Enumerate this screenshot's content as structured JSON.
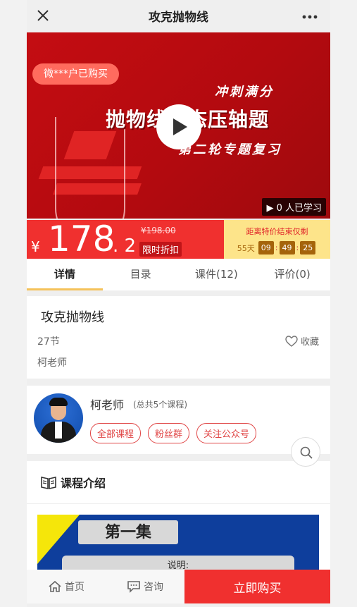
{
  "header": {
    "title": "攻克抛物线"
  },
  "banner": {
    "buyer_badge": "微***户已购买",
    "line1": "冲刺满分",
    "line2": "抛物线动态压轴题",
    "line3": "第二轮专题复习",
    "learners": "0 人已学习"
  },
  "price": {
    "currency": "¥",
    "integer": "178",
    "decimal": ". 2",
    "original": "¥198.00",
    "tag": "限时折扣",
    "countdown_label": "距离特价结束仅剩",
    "days": "55天",
    "hours": "09",
    "minutes": "49",
    "seconds": "25",
    "accent_color": "#f0302f"
  },
  "tabs": [
    {
      "label": "详情"
    },
    {
      "label": "目录"
    },
    {
      "label": "课件(12)"
    },
    {
      "label": "评价(0)"
    }
  ],
  "course": {
    "name": "攻克抛物线",
    "sections": "27节",
    "teacher": "柯老师",
    "favorite_label": "收藏"
  },
  "teacher_card": {
    "name": "柯老师",
    "course_count": "(总共5个课程)",
    "pills": [
      "全部课程",
      "粉丝群",
      "关注公众号"
    ]
  },
  "intro": {
    "heading": "课程介绍",
    "episode": "第一集",
    "note": "说明:"
  },
  "bottom": {
    "home": "首页",
    "consult": "咨询",
    "buy": "立即购买"
  }
}
